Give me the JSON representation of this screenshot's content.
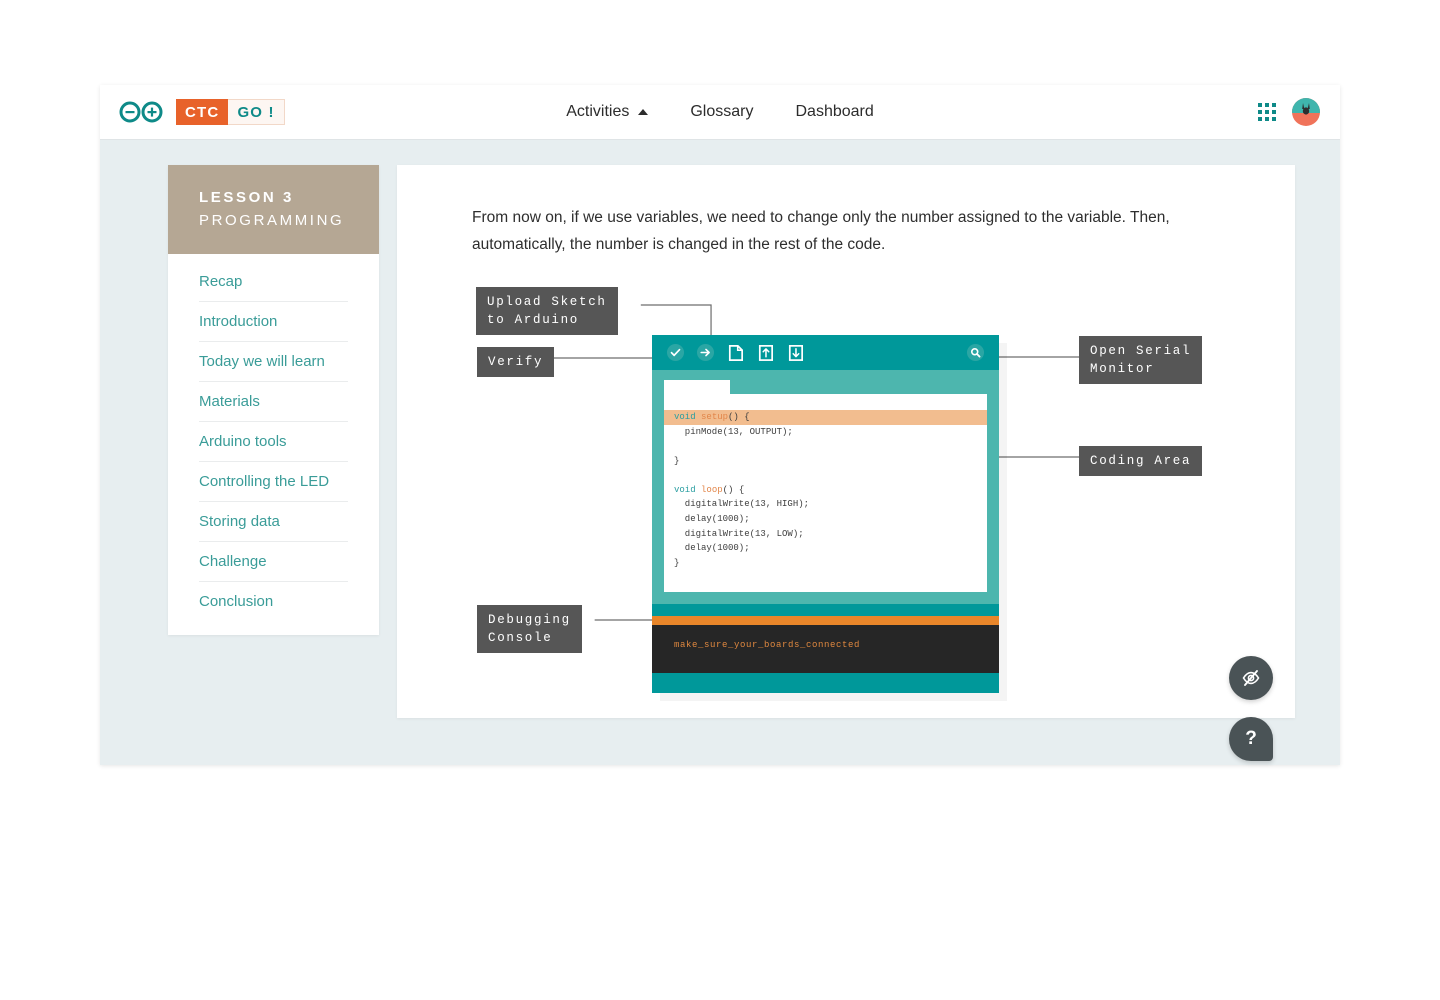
{
  "header": {
    "brand": {
      "arduino_icon": "arduino-infinity-icon",
      "ctc_label": "CTC",
      "go_label": "GO !"
    },
    "nav": [
      {
        "label": "Activities",
        "icon": "caret-up-icon",
        "has_caret": true
      },
      {
        "label": "Glossary",
        "has_caret": false
      },
      {
        "label": "Dashboard",
        "has_caret": false
      }
    ],
    "apps_icon": "apps-grid-icon",
    "avatar_icon": "user-avatar"
  },
  "sidebar": {
    "lesson_number": "LESSON 3",
    "lesson_subject": "PROGRAMMING",
    "items": [
      {
        "label": "Recap"
      },
      {
        "label": "Introduction"
      },
      {
        "label": "Today we will learn"
      },
      {
        "label": "Materials"
      },
      {
        "label": "Arduino tools"
      },
      {
        "label": "Controlling the LED"
      },
      {
        "label": "Storing data"
      },
      {
        "label": "Challenge"
      },
      {
        "label": "Conclusion"
      }
    ]
  },
  "content": {
    "paragraph": "From now on, if we use variables, we need to change only the number assigned to the variable. Then, automatically, the number is changed in the rest of the code."
  },
  "diagram": {
    "callouts": {
      "upload": "Upload Sketch\nto Arduino",
      "verify": "Verify",
      "serial_monitor": "Open Serial\nMonitor",
      "coding_area": "Coding Area",
      "debugging_console": "Debugging\nConsole"
    },
    "toolbar_icons": [
      "verify-check-icon",
      "upload-arrow-icon",
      "new-sketch-icon",
      "open-sketch-icon",
      "save-sketch-icon",
      "serial-monitor-search-icon"
    ],
    "code_lines": {
      "line1_kw": "void",
      "line1_fn": "setup",
      "line1_tail": "() {",
      "line2": "  pinMode(13, OUTPUT);",
      "line3": "}",
      "line4_kw": "void",
      "line4_fn": "loop",
      "line4_tail": "() {",
      "line5": "  digitalWrite(13, HIGH);",
      "line6": "  delay(1000);",
      "line7": "  digitalWrite(13, LOW);",
      "line8": "  delay(1000);",
      "line9": "}"
    },
    "console_message": "make_sure_your_boards_connected"
  },
  "floating": {
    "hide_label": "hide-eye-icon",
    "help_label": "?"
  },
  "colors": {
    "teal": "#00989a",
    "light_teal": "#4db6ae",
    "orange": "#e8862a",
    "brand_orange": "#e8622a",
    "taupe": "#b5a794",
    "dark_gray": "#565656",
    "page_bg": "#e7eef0"
  }
}
